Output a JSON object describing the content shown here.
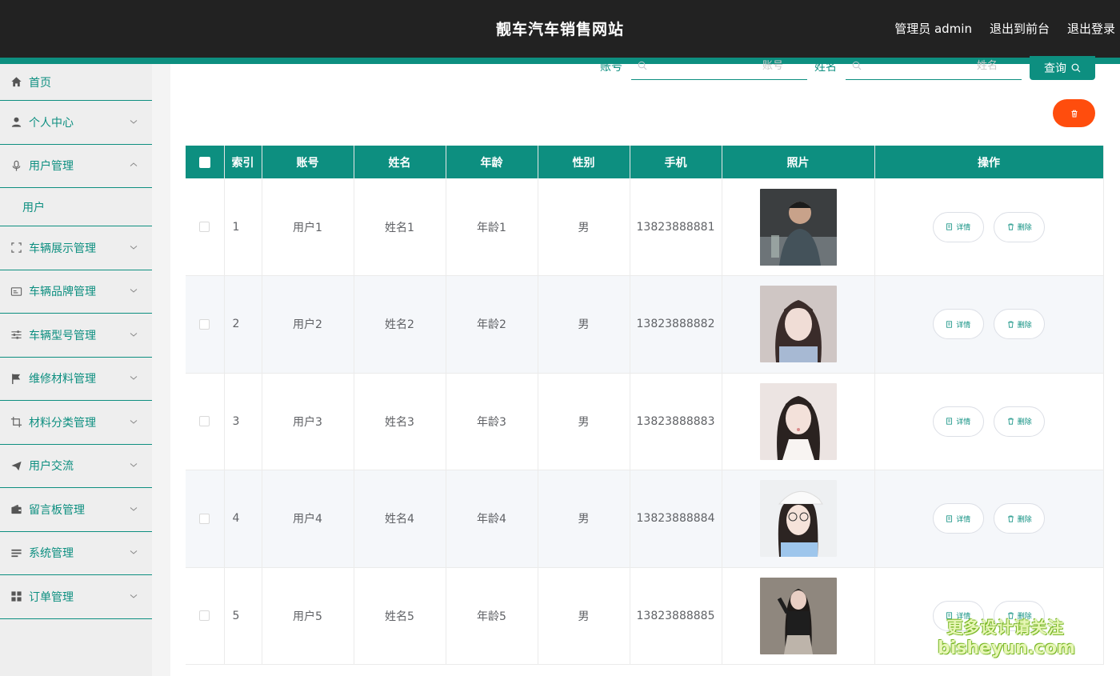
{
  "header": {
    "title": "靓车汽车销售网站",
    "links": [
      "管理员 admin",
      "退出到前台",
      "退出登录"
    ]
  },
  "sidebar": {
    "items": [
      {
        "label": "首页",
        "icon": "home-icon"
      },
      {
        "label": "个人中心",
        "icon": "user-icon"
      },
      {
        "label": "用户管理",
        "icon": "microphone-icon",
        "expanded": true
      },
      {
        "label": "用户",
        "sub": true
      },
      {
        "label": "车辆展示管理",
        "icon": "fullscreen-icon"
      },
      {
        "label": "车辆品牌管理",
        "icon": "id-card-icon"
      },
      {
        "label": "车辆型号管理",
        "icon": "sliders-icon"
      },
      {
        "label": "维修材料管理",
        "icon": "flag-icon"
      },
      {
        "label": "材料分类管理",
        "icon": "crop-icon"
      },
      {
        "label": "用户交流",
        "icon": "send-icon"
      },
      {
        "label": "留言板管理",
        "icon": "wallet-icon"
      },
      {
        "label": "系统管理",
        "icon": "list-icon"
      },
      {
        "label": "订单管理",
        "icon": "grid-icon"
      }
    ]
  },
  "search": {
    "account_label": "账号",
    "account_placeholder": "账号",
    "name_label": "姓名",
    "name_placeholder": "姓名",
    "query_label": "查询"
  },
  "table": {
    "columns": [
      "索引",
      "账号",
      "姓名",
      "年龄",
      "性别",
      "手机",
      "照片",
      "操作"
    ],
    "rows": [
      {
        "index": "1",
        "account": "用户1",
        "name": "姓名1",
        "age": "年龄1",
        "gender": "男",
        "phone": "13823888881"
      },
      {
        "index": "2",
        "account": "用户2",
        "name": "姓名2",
        "age": "年龄2",
        "gender": "男",
        "phone": "13823888882"
      },
      {
        "index": "3",
        "account": "用户3",
        "name": "姓名3",
        "age": "年龄3",
        "gender": "男",
        "phone": "13823888883"
      },
      {
        "index": "4",
        "account": "用户4",
        "name": "姓名4",
        "age": "年龄4",
        "gender": "男",
        "phone": "13823888884"
      },
      {
        "index": "5",
        "account": "用户5",
        "name": "姓名5",
        "age": "年龄5",
        "gender": "男",
        "phone": "13823888885"
      }
    ],
    "detail_label": "详情",
    "delete_label": "删除"
  },
  "watermark": {
    "line1": "更多设计请关注",
    "line2": "bisheyun.com"
  },
  "colors": {
    "accent": "#0d8f80",
    "header_bg": "#222222",
    "danger": "#ff4d0d"
  }
}
